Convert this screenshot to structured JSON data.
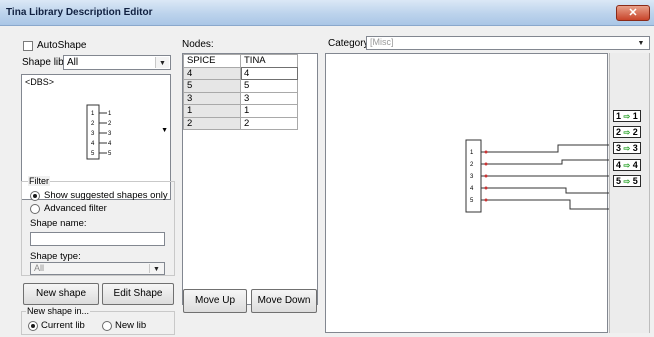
{
  "window": {
    "title": "Tina Library Description Editor",
    "close_glyph": "✕"
  },
  "left": {
    "autoshape_label": "AutoShape",
    "shape_lib_label": "Shape lib:",
    "shape_lib_value": "All",
    "shape_list_first_item": "<DBS>",
    "filter": {
      "group_label": "Filter",
      "opt1": "Show suggested shapes only",
      "opt2": "Advanced filter",
      "shape_name_label": "Shape name:",
      "shape_name_value": "",
      "shape_type_label": "Shape type:",
      "shape_type_value": "All"
    },
    "new_shape_button": "New shape",
    "edit_shape_button": "Edit Shape",
    "new_shape_in": {
      "group_label": "New shape in...",
      "opt1": "Current lib",
      "opt2": "New lib"
    }
  },
  "nodes": {
    "label": "Nodes:",
    "headers": [
      "SPICE",
      "TINA"
    ],
    "rows": [
      [
        "4",
        "4"
      ],
      [
        "5",
        "5"
      ],
      [
        "3",
        "3"
      ],
      [
        "1",
        "1"
      ],
      [
        "2",
        "2"
      ]
    ],
    "move_up_button": "Move Up",
    "move_down_button": "Move Down"
  },
  "right": {
    "category_label": "Category",
    "category_value": "[Misc]",
    "pins": [
      {
        "num": "1",
        "arrow": "⇨",
        "net": "1"
      },
      {
        "num": "2",
        "arrow": "⇨",
        "net": "2"
      },
      {
        "num": "3",
        "arrow": "⇨",
        "net": "3"
      },
      {
        "num": "4",
        "arrow": "⇨",
        "net": "4"
      },
      {
        "num": "5",
        "arrow": "⇨",
        "net": "5"
      }
    ]
  },
  "shape_preview_pins": [
    "1",
    "2",
    "3",
    "4",
    "5"
  ]
}
